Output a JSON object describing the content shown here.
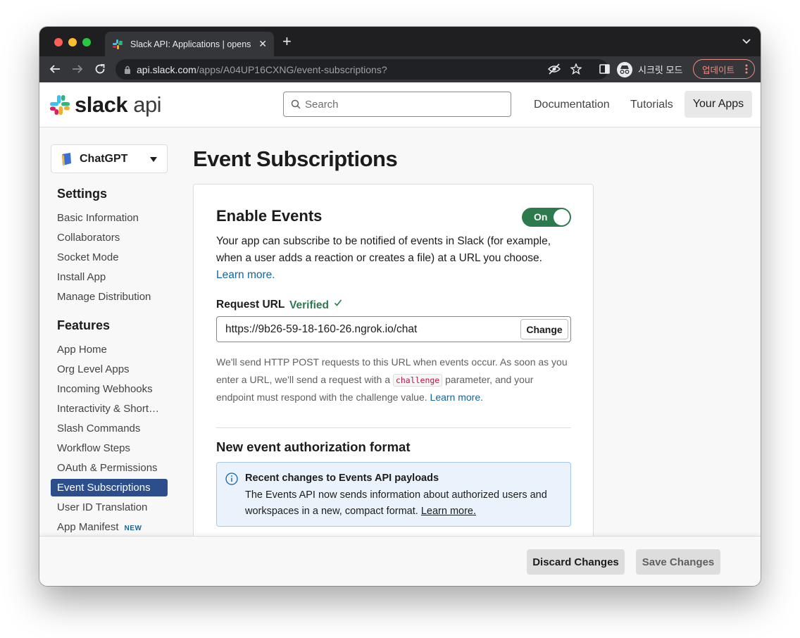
{
  "browser": {
    "tab_title": "Slack API: Applications | opens",
    "new_tab": "+",
    "url_host": "api.slack.com",
    "url_path": "/apps/A04UP16CXNG/event-subscriptions?",
    "incognito_label": "시크릿 모드",
    "update_label": "업데이트"
  },
  "header": {
    "logo_bold": "slack",
    "logo_light": "api",
    "search_placeholder": "Search",
    "nav": [
      "Documentation",
      "Tutorials",
      "Your Apps"
    ]
  },
  "sidebar": {
    "app_name": "ChatGPT",
    "settings_heading": "Settings",
    "settings_items": [
      "Basic Information",
      "Collaborators",
      "Socket Mode",
      "Install App",
      "Manage Distribution"
    ],
    "features_heading": "Features",
    "features_items": [
      "App Home",
      "Org Level Apps",
      "Incoming Webhooks",
      "Interactivity & Short…",
      "Slash Commands",
      "Workflow Steps",
      "OAuth & Permissions",
      "Event Subscriptions",
      "User ID Translation",
      "App Manifest"
    ],
    "active_item": "Event Subscriptions",
    "new_badge": "NEW"
  },
  "main": {
    "page_title": "Event Subscriptions",
    "enable_heading": "Enable Events",
    "toggle_label": "On",
    "description": "Your app can subscribe to be notified of events in Slack (for example, when a user adds a reaction or creates a file) at a URL you choose.",
    "learn_more": "Learn more.",
    "request_url_label": "Request URL",
    "verified_label": "Verified",
    "request_url_value": "https://9b26-59-18-160-26.ngrok.io/chat",
    "change_label": "Change",
    "help_part1": "We'll send HTTP POST requests to this URL when events occur. As soon as you enter a URL, we'll send a request with a",
    "help_code": "challenge",
    "help_part2": "parameter, and your endpoint must respond with the challenge value.",
    "help_link": "Learn more.",
    "auth_heading": "New event authorization format",
    "info_title": "Recent changes to Events API payloads",
    "info_body": "The Events API now sends information about authorized users and workspaces in a new, compact format.",
    "info_link": "Learn more."
  },
  "footer": {
    "discard_label": "Discard Changes",
    "save_label": "Save Changes"
  },
  "colors": {
    "accent_blue": "#2c4f8c",
    "toggle_green": "#2d7a4f",
    "link": "#1264a3",
    "update_pink": "#f28b82"
  }
}
